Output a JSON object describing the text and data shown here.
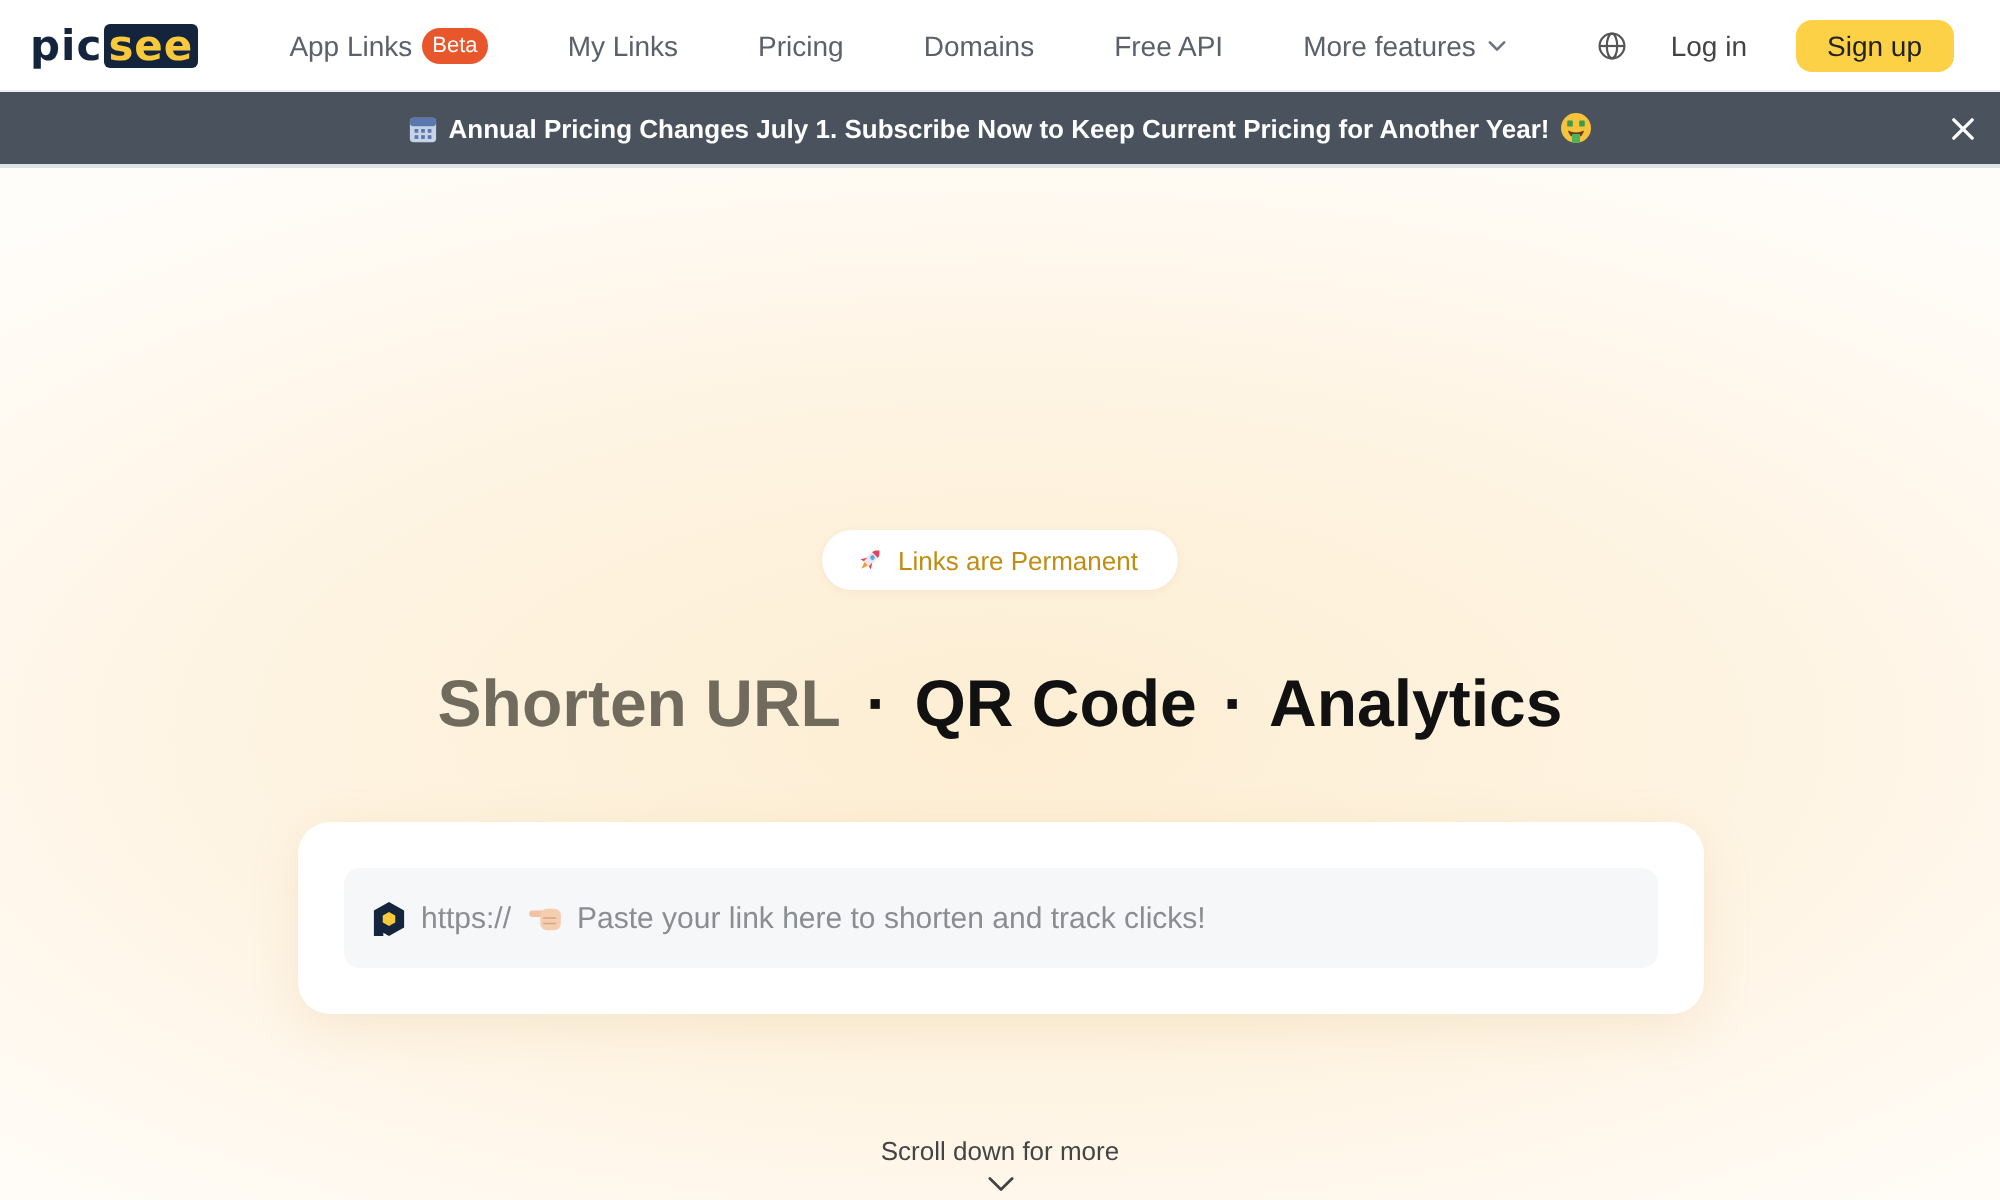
{
  "nav": {
    "logo": {
      "dark_part": "pic",
      "highlight_part": "see"
    },
    "links": [
      {
        "kind": "link",
        "label": "App Links",
        "badge": "Beta"
      },
      {
        "kind": "link",
        "label": "My Links"
      },
      {
        "kind": "link",
        "label": "Pricing"
      },
      {
        "kind": "link",
        "label": "Domains"
      },
      {
        "kind": "link",
        "label": "Free API"
      },
      {
        "kind": "dropdown",
        "label": "More features"
      }
    ],
    "login": "Log in",
    "signup": "Sign up"
  },
  "announcement": {
    "text": "Annual Pricing Changes July 1. Subscribe Now to Keep Current Pricing for Another Year!"
  },
  "hero": {
    "tag": "Links are Permanent",
    "headline": [
      {
        "kind": "phrase",
        "text": "Shorten URL",
        "dimmed": true
      },
      {
        "kind": "separator",
        "text": "·"
      },
      {
        "kind": "phrase",
        "text": "QR Code",
        "dimmed": false
      },
      {
        "kind": "separator",
        "text": "·"
      },
      {
        "kind": "phrase",
        "text": "Analytics",
        "dimmed": false
      }
    ],
    "url_box": {
      "prefix": "https://",
      "placeholder": "Paste your link here to shorten and track clicks!"
    },
    "scroll_hint": "Scroll down for more"
  }
}
